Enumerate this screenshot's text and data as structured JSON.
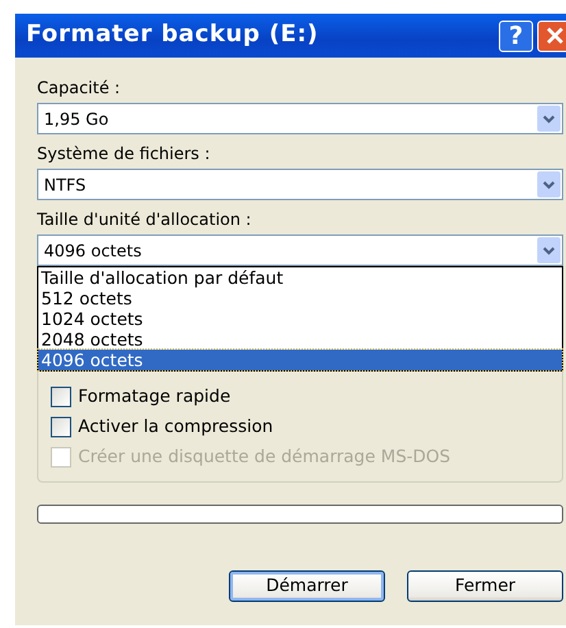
{
  "window": {
    "title": "Formater backup (E:)",
    "help_button": "?"
  },
  "fields": [
    {
      "label": "Capacité :",
      "value": "1,95 Go"
    },
    {
      "label": "Système de fichiers :",
      "value": "NTFS"
    },
    {
      "label": "Taille d'unité d'allocation :",
      "value": "4096 octets",
      "expanded": true,
      "options": [
        {
          "label": "Taille d'allocation par défaut",
          "selected": false
        },
        {
          "label": "512 octets",
          "selected": false
        },
        {
          "label": "1024 octets",
          "selected": false
        },
        {
          "label": "2048 octets",
          "selected": false
        },
        {
          "label": "4096 octets",
          "selected": true
        }
      ]
    }
  ],
  "options": [
    {
      "label": "Formatage rapide",
      "checked": false,
      "disabled": false
    },
    {
      "label": "Activer la compression",
      "checked": false,
      "disabled": false
    },
    {
      "label": "Créer une disquette de démarrage MS-DOS",
      "checked": false,
      "disabled": true
    }
  ],
  "progress": {
    "level": 0
  },
  "buttons": [
    {
      "label": "Démarrer",
      "default": true
    },
    {
      "label": "Fermer",
      "default": false
    }
  ]
}
